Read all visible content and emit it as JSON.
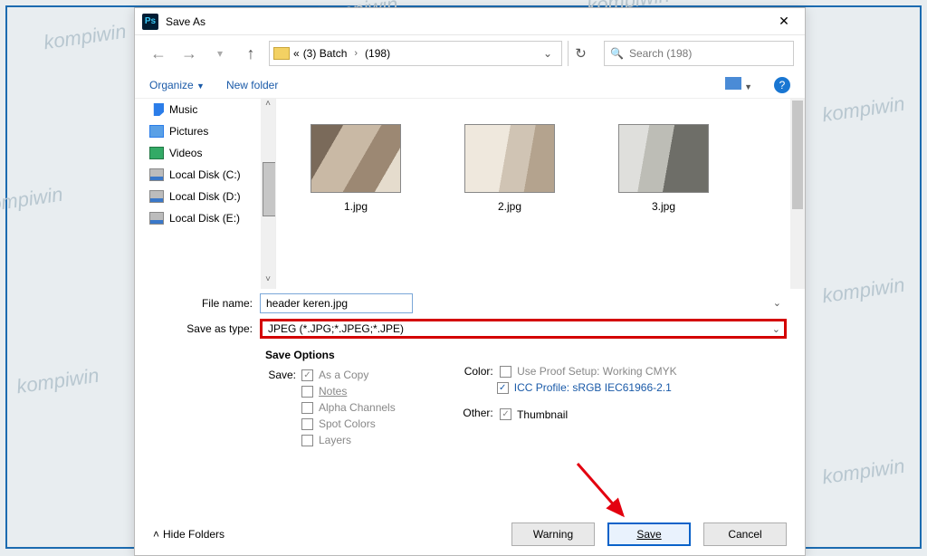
{
  "window": {
    "title": "Save As"
  },
  "nav": {
    "path_prefix": "«",
    "crumb1": "(3) Batch",
    "crumb2": "(198)",
    "search_placeholder": "Search (198)"
  },
  "toolbar": {
    "organize": "Organize",
    "newfolder": "New folder"
  },
  "tree": {
    "items": [
      {
        "label": "Music"
      },
      {
        "label": "Pictures"
      },
      {
        "label": "Videos"
      },
      {
        "label": "Local Disk (C:)"
      },
      {
        "label": "Local Disk (D:)"
      },
      {
        "label": "Local Disk (E:)"
      }
    ]
  },
  "files": [
    {
      "label": "1.jpg"
    },
    {
      "label": "2.jpg"
    },
    {
      "label": "3.jpg"
    }
  ],
  "form": {
    "filename_label": "File name:",
    "filename_value": "header keren.jpg",
    "type_label": "Save as type:",
    "type_value": "JPEG (*.JPG;*.JPEG;*.JPE)"
  },
  "options": {
    "heading": "Save Options",
    "save_label": "Save:",
    "as_copy": "As a Copy",
    "notes": "Notes",
    "alpha": "Alpha Channels",
    "spot": "Spot Colors",
    "layers": "Layers",
    "color_label": "Color:",
    "proof": "Use Proof Setup: Working CMYK",
    "icc": "ICC Profile:  sRGB IEC61966-2.1",
    "other_label": "Other:",
    "thumb": "Thumbnail"
  },
  "footer": {
    "hide": "Hide Folders",
    "warning": "Warning",
    "save": "Save",
    "cancel": "Cancel"
  },
  "watermark": "kompiwin"
}
